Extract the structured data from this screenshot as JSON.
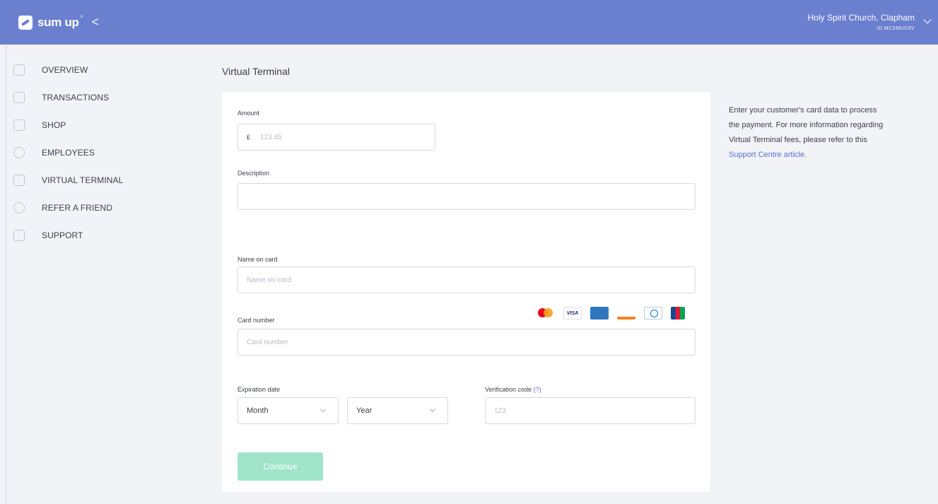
{
  "brand": {
    "name": "sum up",
    "sup": "°",
    "accent": "#6b7fcf",
    "collapse_glyph": "<"
  },
  "merchant": {
    "name": "Holy Spirit Church, Clapham",
    "id": "ID MCSMUD3V"
  },
  "sidebar": {
    "items": [
      {
        "label": "OVERVIEW",
        "icon": "overview-icon"
      },
      {
        "label": "TRANSACTIONS",
        "icon": "transactions-icon"
      },
      {
        "label": "SHOP",
        "icon": "shop-icon"
      },
      {
        "label": "EMPLOYEES",
        "icon": "employees-icon"
      },
      {
        "label": "VIRTUAL TERMINAL",
        "icon": "virtual-terminal-icon"
      },
      {
        "label": "REFER A FRIEND",
        "icon": "refer-icon"
      },
      {
        "label": "SUPPORT",
        "icon": "support-icon"
      }
    ]
  },
  "main": {
    "title": "Virtual Terminal",
    "amount": {
      "label": "Amount",
      "currency": "£",
      "placeholder": "123.45"
    },
    "description": {
      "label": "Description",
      "value": ""
    },
    "name_on_card": {
      "label": "Name on card",
      "placeholder": "Name on card"
    },
    "card_number": {
      "label": "Card number",
      "placeholder": "Card number",
      "brands": [
        "mastercard",
        "visa",
        "amex",
        "discover",
        "diners",
        "jcb"
      ],
      "visa_text": "VISA"
    },
    "expiration": {
      "label": "Expiration date",
      "month": "Month",
      "year": "Year"
    },
    "verification": {
      "label": "Verification code",
      "help": "(?)",
      "placeholder": "123"
    },
    "continue_label": "Continue",
    "continue_color": "#9fe4ca"
  },
  "info": {
    "text": "Enter your customer's card data to process the payment. For more information regarding Virtual Terminal fees, please refer to this ",
    "link": "Support Centre article."
  }
}
